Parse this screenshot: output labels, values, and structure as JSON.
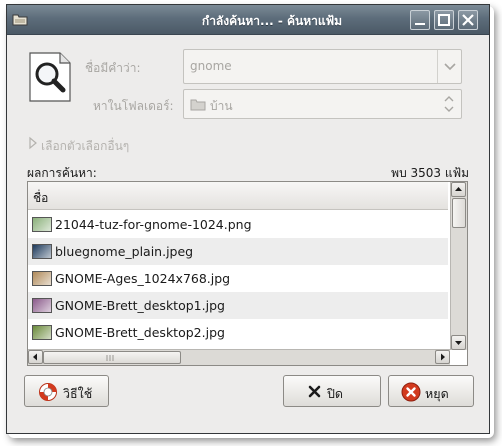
{
  "window": {
    "title": "กำลังค้นหา... - ค้นหาแฟ้ม"
  },
  "search": {
    "name_label": "ชื่อมีคำว่า:",
    "name_value": "gnome",
    "folder_label": "หาในโฟลเดอร์:",
    "folder_value": "บ้าน",
    "more_options_label": "เลือกตัวเลือกอื่นๆ"
  },
  "results": {
    "label": "ผลการค้นหา:",
    "count_text": "พบ 3503 แฟ้ม",
    "column_header": "ชื่อ",
    "items": [
      {
        "name": "21044-tuz-for-gnome-1024.png",
        "thumb_color": "#8ab07a"
      },
      {
        "name": "bluegnome_plain.jpeg",
        "thumb_color": "#1d3a5c"
      },
      {
        "name": "GNOME-Ages_1024x768.jpg",
        "thumb_color": "#b08a5a"
      },
      {
        "name": "GNOME-Brett_desktop1.jpg",
        "thumb_color": "#8a5a8a"
      },
      {
        "name": "GNOME-Brett_desktop2.jpg",
        "thumb_color": "#6a8a3a"
      }
    ]
  },
  "buttons": {
    "help_label": "วิธีใช้",
    "close_label": "ปิด",
    "stop_label": "หยุด"
  },
  "icons": {
    "titlebar": "folder-icon",
    "find": "magnifier-document-icon",
    "help": "lifebuoy-icon",
    "close": "x-icon",
    "stop": "stop-icon"
  },
  "colors": {
    "titlebar": "#5d6d7b",
    "window_bg": "#edeceb",
    "disabled_text": "#a8a6a2",
    "stop_red": "#d23a1e"
  }
}
